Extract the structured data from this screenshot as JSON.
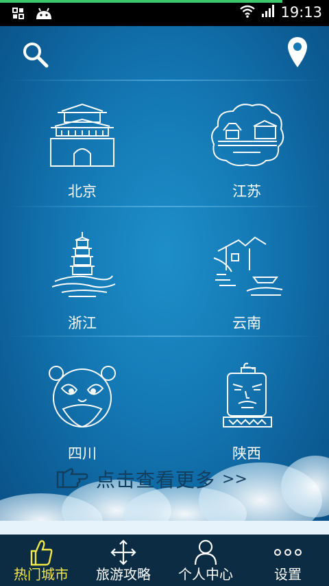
{
  "statusbar": {
    "time": "19:13"
  },
  "cities": [
    {
      "name": "北京",
      "icon": "beijing-gate-icon"
    },
    {
      "name": "江苏",
      "icon": "jiangsu-pavilion-icon"
    },
    {
      "name": "浙江",
      "icon": "zhejiang-pagoda-icon"
    },
    {
      "name": "云南",
      "icon": "yunnan-house-icon"
    },
    {
      "name": "四川",
      "icon": "sichuan-panda-icon"
    },
    {
      "name": "陕西",
      "icon": "shaanxi-warrior-icon"
    }
  ],
  "more": {
    "label": "点击查看更多",
    "arrows": ">>"
  },
  "nav": {
    "items": [
      {
        "label": "热门城市",
        "icon": "thumbs-up-icon",
        "active": true
      },
      {
        "label": "旅游攻略",
        "icon": "move-arrows-icon",
        "active": false
      },
      {
        "label": "个人中心",
        "icon": "person-icon",
        "active": false
      },
      {
        "label": "设置",
        "icon": "more-dots-icon",
        "active": false
      }
    ]
  },
  "colors": {
    "active_tab": "#f4e84a",
    "nav_bg": "#0b2c43",
    "main_bg": "#1479b5"
  }
}
